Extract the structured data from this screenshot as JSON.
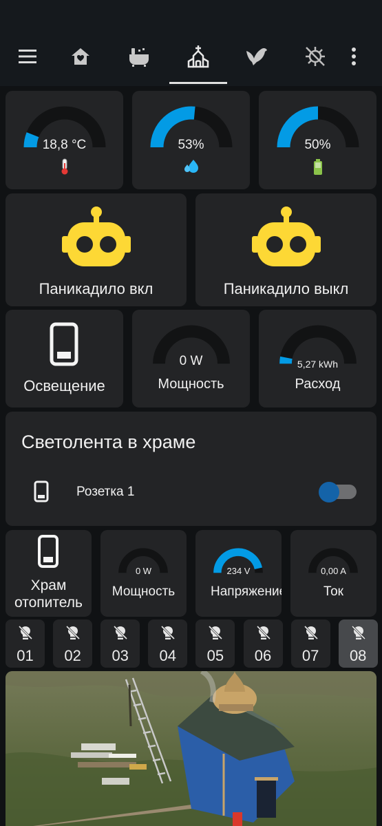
{
  "nav": {
    "tabs": [
      {
        "icon": "menu-icon"
      },
      {
        "icon": "home-heart-icon"
      },
      {
        "icon": "bathtub-icon"
      },
      {
        "icon": "church-icon",
        "active": true
      },
      {
        "icon": "bird-icon"
      },
      {
        "icon": "virus-off-icon"
      },
      {
        "icon": "more-vertical-icon"
      }
    ]
  },
  "sensors": {
    "temperature": {
      "value": "18,8 °C",
      "icon": "thermometer-icon",
      "level": 0.12
    },
    "humidity": {
      "value": "53%",
      "icon": "water-drops-icon",
      "level": 0.53
    },
    "battery": {
      "value": "50%",
      "icon": "battery-icon",
      "level": 0.5
    }
  },
  "scripts": {
    "on": {
      "label": "Паникадило вкл",
      "icon": "robot-icon"
    },
    "off": {
      "label": "Паникадило выкл",
      "icon": "robot-icon"
    }
  },
  "lighting": {
    "label": "Освещение",
    "icon": "phone-switch-icon",
    "power": {
      "value": "0 W",
      "label": "Мощность",
      "level": 0
    },
    "consumption": {
      "value": "5,27 kWh",
      "label": "Расход",
      "level": 0.06
    }
  },
  "led_strip": {
    "title": "Светолента в храме",
    "entity_label": "Розетка 1",
    "entity_icon": "phone-switch-icon",
    "state": "on"
  },
  "heater": {
    "label": "Храм\nотопитель",
    "icon": "phone-switch-icon",
    "power": {
      "value": "0 W",
      "label": "Мощность",
      "level": 0
    },
    "voltage": {
      "value": "234 V",
      "label": "Напряжение",
      "level": 0.93
    },
    "current": {
      "value": "0,00 A",
      "label": "Ток",
      "level": 0
    }
  },
  "slots": [
    "01",
    "02",
    "03",
    "04",
    "05",
    "06",
    "07",
    "08"
  ],
  "colors": {
    "gauge_fill": "#039be5",
    "gauge_track": "#121314",
    "robot": "#fdd835",
    "card": "#232426",
    "toggle_on": "#1463a8"
  }
}
